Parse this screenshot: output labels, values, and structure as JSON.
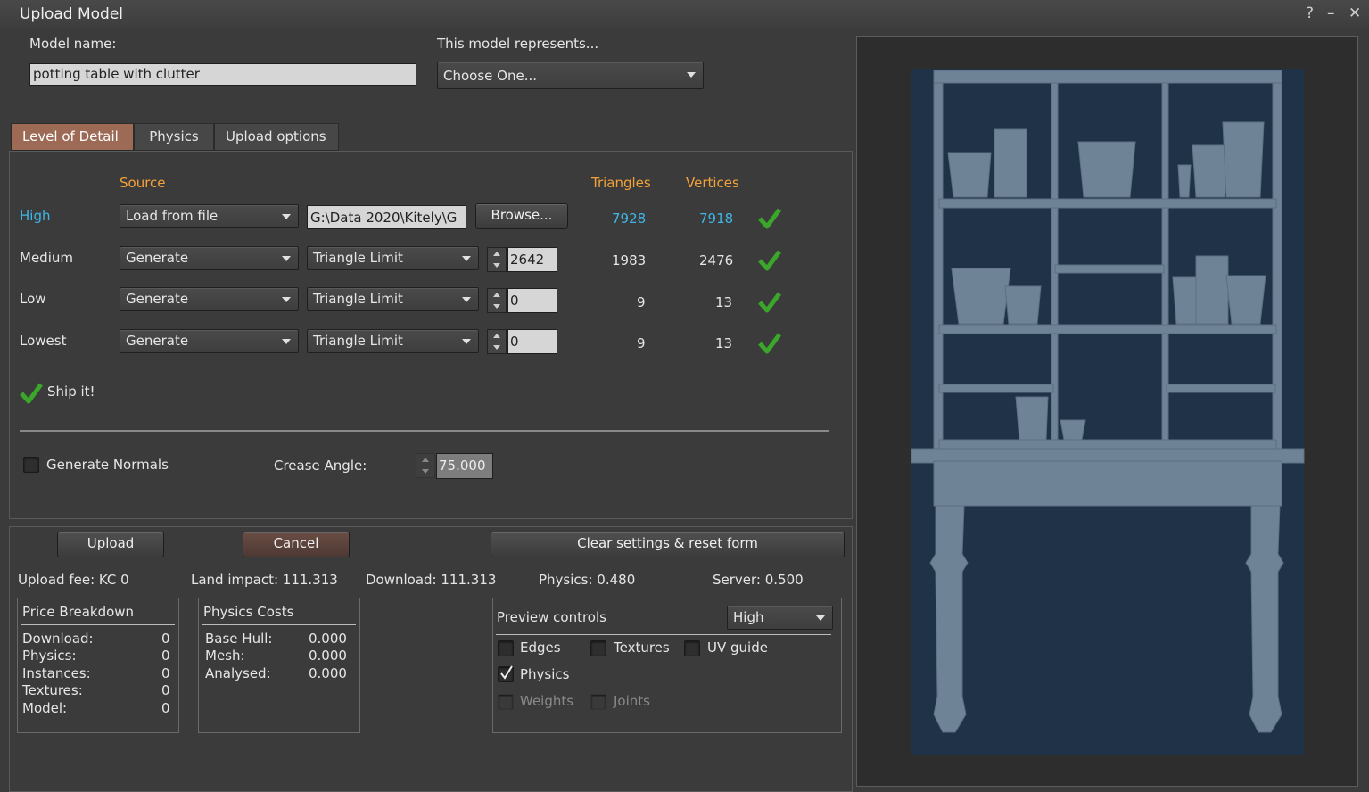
{
  "window": {
    "title": "Upload Model",
    "help": "?",
    "minimize": "–",
    "close": "✕"
  },
  "model_name": {
    "label": "Model name:",
    "value": "potting table with clutter"
  },
  "represents": {
    "label": "This model represents...",
    "value": "Choose One..."
  },
  "tabs": [
    {
      "label": "Level of Detail",
      "active": true
    },
    {
      "label": "Physics",
      "active": false
    },
    {
      "label": "Upload options",
      "active": false
    }
  ],
  "lod": {
    "headers": {
      "source": "Source",
      "triangles": "Triangles",
      "vertices": "Vertices"
    },
    "rows": [
      {
        "label": "High",
        "source": "Load from file",
        "path": "G:\\Data 2020\\Kitely\\G",
        "browse": "Browse...",
        "triangles": "7928",
        "vertices": "7918"
      },
      {
        "label": "Medium",
        "source": "Generate",
        "mode": "Triangle Limit",
        "limit": "2642",
        "triangles": "1983",
        "vertices": "2476"
      },
      {
        "label": "Low",
        "source": "Generate",
        "mode": "Triangle Limit",
        "limit": "0",
        "triangles": "9",
        "vertices": "13"
      },
      {
        "label": "Lowest",
        "source": "Generate",
        "mode": "Triangle Limit",
        "limit": "0",
        "triangles": "9",
        "vertices": "13"
      }
    ],
    "ship_it": "Ship it!",
    "generate_normals": "Generate Normals",
    "crease_angle_label": "Crease Angle:",
    "crease_angle_value": "75.000"
  },
  "actions": {
    "upload": "Upload",
    "cancel": "Cancel",
    "reset": "Clear settings & reset form"
  },
  "stats": {
    "upload_fee": "Upload fee: KC 0",
    "land_impact": "Land impact: 111.313",
    "download": "Download: 111.313",
    "physics": "Physics: 0.480",
    "server": "Server: 0.500"
  },
  "price_breakdown": {
    "title": "Price Breakdown",
    "rows": [
      {
        "label": "Download:",
        "value": "0"
      },
      {
        "label": "Physics:",
        "value": "0"
      },
      {
        "label": "Instances:",
        "value": "0"
      },
      {
        "label": "Textures:",
        "value": "0"
      },
      {
        "label": "Model:",
        "value": "0"
      }
    ]
  },
  "physics_costs": {
    "title": "Physics Costs",
    "rows": [
      {
        "label": "Base Hull:",
        "value": "0.000"
      },
      {
        "label": "Mesh:",
        "value": "0.000"
      },
      {
        "label": "Analysed:",
        "value": "0.000"
      }
    ]
  },
  "preview_controls": {
    "title": "Preview controls",
    "lod_select": "High",
    "edges": "Edges",
    "textures": "Textures",
    "uv_guide": "UV guide",
    "physics": "Physics",
    "weights": "Weights",
    "joints": "Joints"
  },
  "colors": {
    "accent_orange": "#f3a23a",
    "accent_blue": "#3fb6e5",
    "active_tab": "#9c6a55",
    "viewport_bg": "#1f3248",
    "model": "#6f8397"
  }
}
